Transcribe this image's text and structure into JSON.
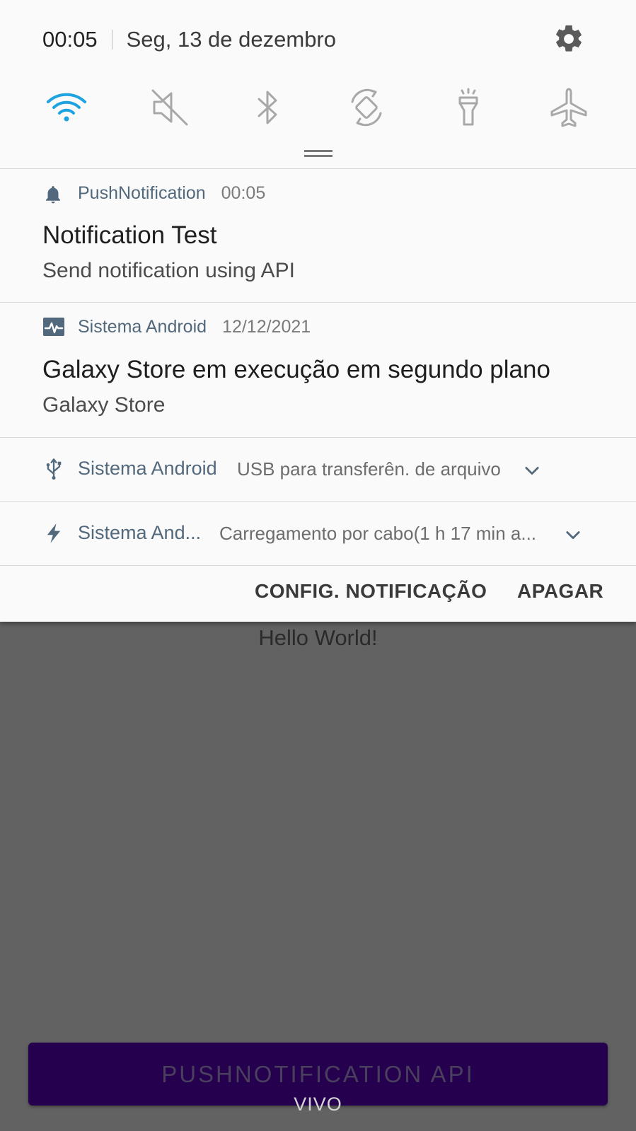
{
  "status": {
    "time": "00:05",
    "date": "Seg, 13 de dezembro"
  },
  "icons": {
    "settings": "gear-icon",
    "quick_settings": [
      "wifi-icon",
      "sound-muted-icon",
      "bluetooth-icon",
      "auto-rotate-icon",
      "flashlight-icon",
      "airplane-mode-icon"
    ]
  },
  "colors": {
    "wifi_active": "#1fa3e0",
    "app_name": "#52687c",
    "app_button": "#24004f",
    "background": "#626262"
  },
  "notifications": [
    {
      "app": "PushNotification",
      "time": "00:05",
      "title": "Notification Test",
      "text": "Send notification using API",
      "icon": "bell-icon"
    },
    {
      "app": "Sistema Android",
      "time": "12/12/2021",
      "title": "Galaxy Store em execução em segundo plano",
      "text": "Galaxy Store",
      "icon": "activity-icon"
    },
    {
      "app": "Sistema Android",
      "summary": "USB para transferên. de arquivo",
      "icon": "usb-icon"
    },
    {
      "app": "Sistema And...",
      "summary": "Carregamento por cabo(1 h 17 min a...",
      "icon": "charging-bolt-icon"
    }
  ],
  "actions": {
    "settings": "CONFIG. NOTIFICAÇÃO",
    "clear": "APAGAR"
  },
  "app": {
    "text": "Hello World!",
    "button": "PUSHNOTIFICATION API"
  },
  "carrier": "VIVO"
}
